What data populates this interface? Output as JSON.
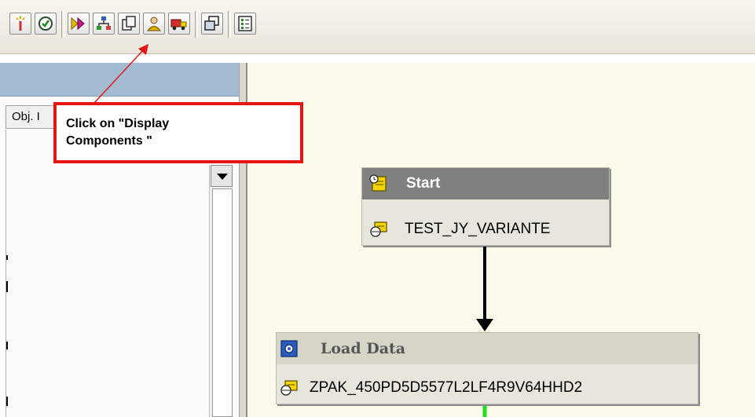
{
  "toolbar": {
    "buttons": [
      {
        "icon": "magic-wand-icon"
      },
      {
        "icon": "clock-check-icon"
      },
      {
        "icon": "arrows-process-icon"
      },
      {
        "icon": "display-components-icon"
      },
      {
        "icon": "copy-pages-icon"
      },
      {
        "icon": "user-icon"
      },
      {
        "icon": "truck-icon"
      },
      {
        "icon": "windows-icon"
      },
      {
        "icon": "list-settings-icon"
      }
    ]
  },
  "left_panel": {
    "column_header": "Obj. I"
  },
  "callout": {
    "text_line1": "Click on \"Display",
    "text_line2": "Components \""
  },
  "graph": {
    "start_node": {
      "title": "Start",
      "variant": "TEST_JY_VARIANTE"
    },
    "load_node": {
      "title": "Load Data",
      "variant": "ZPAK_450PD5D5577L2LF4R9V64HHD2"
    }
  },
  "colors": {
    "callout_border": "#e51515",
    "start_header": "#808080",
    "load_header": "#d6d6c8",
    "connector_green": "#22dd22"
  }
}
